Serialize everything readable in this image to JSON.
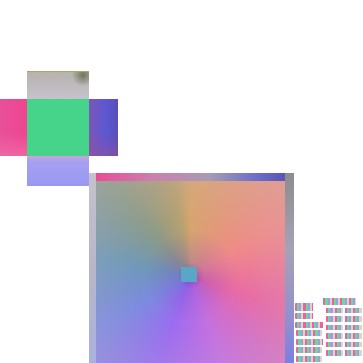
{
  "scene": {
    "description_items": [],
    "colors": {
      "cube_top": "#c6c3cf",
      "cube_left": "#f04490",
      "cube_front": "#45d48a",
      "cube_right": "#5b58d2",
      "cube_bottom": "#9a98f4",
      "panel_marker": "#5aa6c6"
    }
  }
}
